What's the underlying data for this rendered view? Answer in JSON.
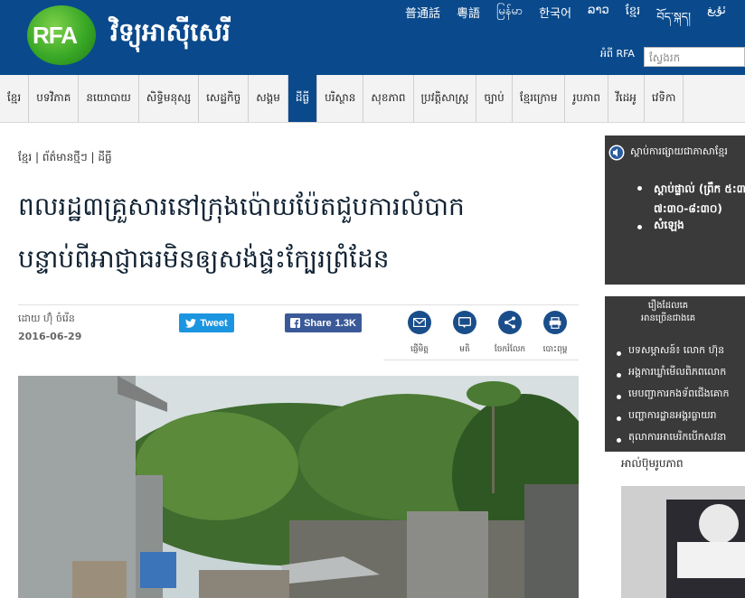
{
  "header": {
    "logo_text": "RFA",
    "site_title": "វិទ្យុអាស៊ីសេរី",
    "languages": [
      "普通話",
      "粵語",
      "မြန်မာ",
      "한국어",
      "ລາວ",
      "ខ្មែរ",
      "བོད་སྐད།",
      "ئۇيغ"
    ],
    "about": "អំពី RFA",
    "search_placeholder": "ស្វែងរក"
  },
  "nav": {
    "items": [
      "ខ្មែរ",
      "បទវិភាគ",
      "នយោបាយ",
      "សិទ្ធិមនុស្ស",
      "សេដ្ឋកិច្ច",
      "សង្គម",
      "ដីធ្លី",
      "បរិស្ថាន",
      "សុខភាព",
      "ប្រវត្តិសាស្ត្រ",
      "ច្បាប់",
      "ខ្មែរក្រោម",
      "រូបភាព",
      "វីដេអូ",
      "វេទិកា"
    ],
    "active_index": 6
  },
  "article": {
    "breadcrumb": "ខ្មែរ | ព័ត៌មានថ្មីៗ | ដីធ្លី",
    "headline_line1": "ពលរដ្ឋ៣គ្រួសារនៅក្រុងប៉ោយប៉ែតជួបការលំបាក",
    "headline_line2": "បន្ទាប់ពីអាជ្ញាធរមិនឲ្យសង់ផ្ទះក្បែរព្រំដែន",
    "byline": "ដោយ ហ៊ុំ ចំរើន",
    "date": "2016-06-29"
  },
  "social": {
    "tweet_label": "Tweet",
    "share_label": "Share",
    "share_count": "1.3K"
  },
  "tools": [
    {
      "icon": "email-icon",
      "label": "ផ្ញើមិត្ត"
    },
    {
      "icon": "comment-icon",
      "label": "មតិ"
    },
    {
      "icon": "share-icon",
      "label": "ចែករំលែក"
    },
    {
      "icon": "print-icon",
      "label": "បោះពុម្ព"
    }
  ],
  "sidebar": {
    "listen_title": "ស្ដាប់ការផ្សាយជាភាសាខ្មែរ",
    "live_label": "ស្ដាប់ផ្ទាល់ (ព្រឹក ៥:៣",
    "live_time": "៧:៣០-៨:៣០)",
    "audio_label": "សំឡេង",
    "popular_title_line1": "រឿងដែលគេ",
    "popular_title_line2": "អានច្រើនជាងគេ",
    "popular_items": [
      "បទសម្ភាសន៍៖ លោក ហ៊ុន",
      "អង្គការឃ្លាំមើលពិភពលោក",
      "មេបញ្ជាការកងទ័ពជើងគោក",
      "បញ្ហាការដ្ឋានអង្គរធ្លាយរា",
      "តុលាការអាមេរិកបើកសវនា"
    ],
    "photos_title": "អាល់ប៊ុមរូបភាព"
  }
}
